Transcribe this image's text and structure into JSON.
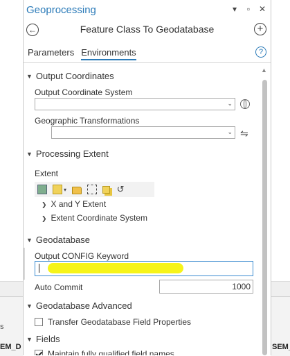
{
  "background": {
    "left_text_1": "s",
    "left_text_2": "EM_D",
    "right_text_2": "SEM_"
  },
  "pane": {
    "title": "Geoprocessing",
    "controls": {
      "pin": "▾",
      "maximize": "▫",
      "close": "✕"
    },
    "tool_title": "Feature Class To Geodatabase",
    "tabs": [
      {
        "label": "Parameters",
        "active": false
      },
      {
        "label": "Environments",
        "active": true
      }
    ]
  },
  "sections": {
    "output_coordinates": {
      "title": "Output Coordinates",
      "output_cs_label": "Output Coordinate System",
      "output_cs_value": "",
      "geo_transform_label": "Geographic Transformations",
      "geo_transform_value": ""
    },
    "processing_extent": {
      "title": "Processing Extent",
      "extent_label": "Extent",
      "items": [
        "X and Y Extent",
        "Extent Coordinate System"
      ]
    },
    "geodatabase": {
      "title": "Geodatabase",
      "config_label": "Output CONFIG Keyword",
      "config_value": "",
      "auto_commit_label": "Auto Commit",
      "auto_commit_value": "1000"
    },
    "geodatabase_advanced": {
      "title": "Geodatabase Advanced",
      "transfer_label": "Transfer Geodatabase Field Properties",
      "transfer_checked": false
    },
    "fields": {
      "title": "Fields",
      "maintain_label": "Maintain fully qualified field names",
      "maintain_checked": true
    }
  },
  "colors": {
    "accent": "#2a7ab8",
    "highlight": "#f6f41a",
    "focus": "#3b8bd0"
  }
}
